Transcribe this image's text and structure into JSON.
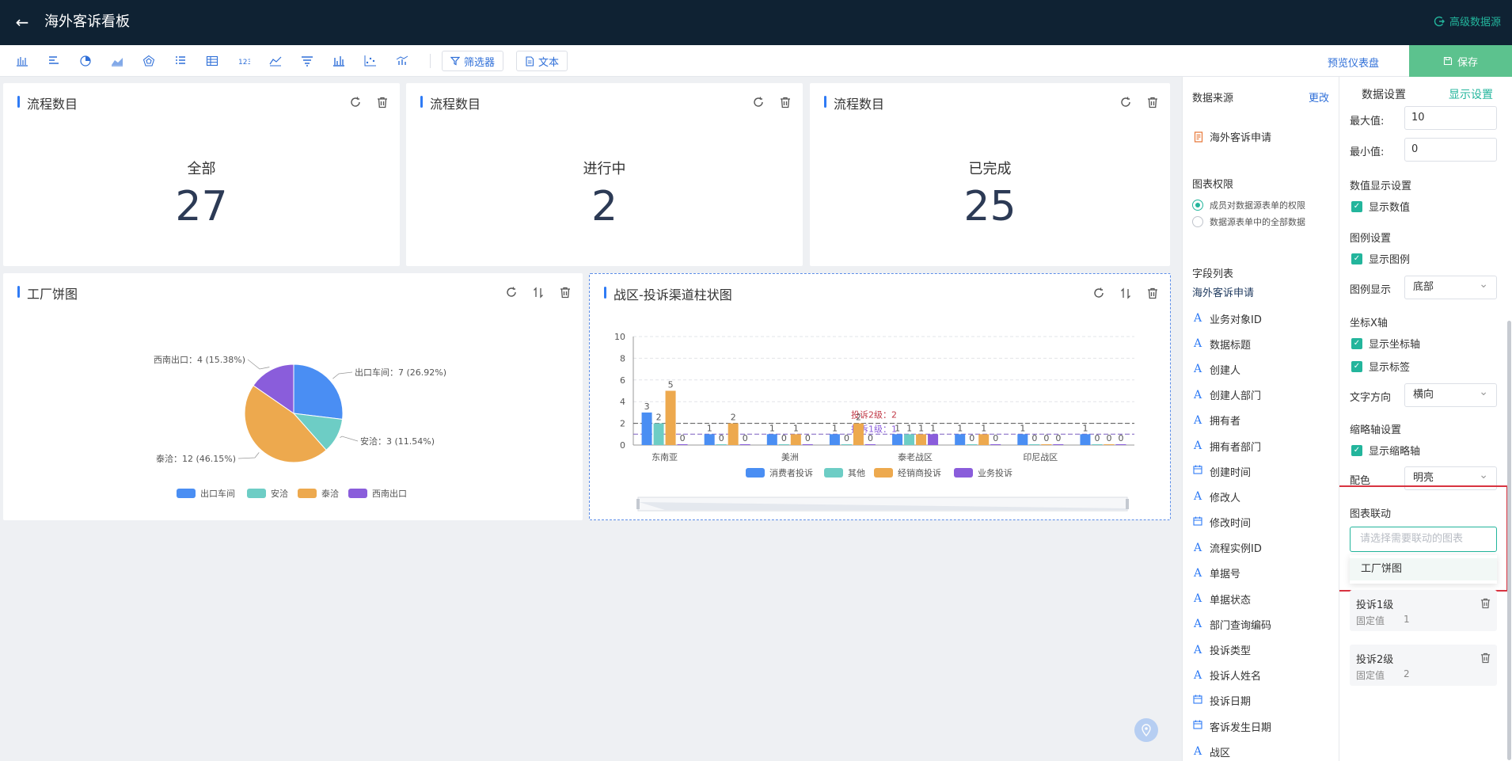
{
  "header": {
    "title": "海外客诉看板",
    "advanced_source": "高级数据源"
  },
  "toolbar": {
    "icons": [
      "bar-chart-icon",
      "horizontal-bar-icon",
      "pie-chart-icon",
      "area-chart-icon",
      "radar-chart-icon",
      "list-icon",
      "table-icon",
      "number-icon",
      "line-chart-icon",
      "funnel-icon",
      "column-chart-icon",
      "scatter-icon",
      "combo-chart-icon"
    ],
    "filter_label": "筛选器",
    "text_label": "文本",
    "preview_label": "预览仪表盘",
    "save_label": "保存"
  },
  "metrics": [
    {
      "title": "流程数目",
      "label": "全部",
      "value": "27"
    },
    {
      "title": "流程数目",
      "label": "进行中",
      "value": "2"
    },
    {
      "title": "流程数目",
      "label": "已完成",
      "value": "25"
    }
  ],
  "pie_card": {
    "title": "工厂饼图"
  },
  "bar_card": {
    "title": "战区-投诉渠道柱状图"
  },
  "chart_data": [
    {
      "type": "pie",
      "title": "工厂饼图",
      "categories": [
        "出口车间",
        "安洽",
        "泰洽",
        "西南出口"
      ],
      "values": [
        7,
        3,
        12,
        4
      ],
      "labels": [
        "出口车间：7 (26.92%)",
        "安洽：3 (11.54%)",
        "泰洽：12 (46.15%)",
        "西南出口：4 (15.38%)"
      ],
      "colors": [
        "#4a8ef3",
        "#6dcdc5",
        "#eda94e",
        "#8a5ddb"
      ],
      "legend": "bottom"
    },
    {
      "type": "bar",
      "title": "战区-投诉渠道柱状图",
      "ylim": [
        0,
        10
      ],
      "y_ticks": [
        "0",
        "2",
        "4",
        "6",
        "8",
        "10"
      ],
      "categories": [
        "东南亚",
        "",
        "美洲",
        "",
        "泰老战区",
        "",
        "印尼战区",
        ""
      ],
      "series": [
        {
          "name": "消费者投诉",
          "color": "#4a8ef3",
          "values": [
            3,
            1,
            1,
            1,
            1,
            1,
            1,
            1
          ]
        },
        {
          "name": "其他",
          "color": "#6dcdc5",
          "values": [
            2,
            0,
            0,
            0,
            1,
            0,
            0,
            0
          ]
        },
        {
          "name": "经销商投诉",
          "color": "#eda94e",
          "values": [
            5,
            2,
            1,
            2,
            1,
            1,
            0,
            0
          ]
        },
        {
          "name": "业务投诉",
          "color": "#8a5ddb",
          "values": [
            0,
            0,
            0,
            0,
            1,
            0,
            0,
            0
          ]
        }
      ],
      "reference_lines": [
        {
          "label": "投诉2级：2",
          "y": 2
        },
        {
          "label": "投诉1级：1",
          "y": 1
        }
      ],
      "grid": true,
      "legend": "bottom"
    }
  ],
  "field_panel": {
    "source_heading": "数据来源",
    "change_label": "更改",
    "source_name": "海外客诉申请",
    "perm_heading": "图表权限",
    "perm_options": [
      "成员对数据源表单的权限",
      "数据源表单中的全部数据"
    ],
    "fields_heading": "字段列表",
    "form_name": "海外客诉申请",
    "fields": [
      {
        "icon": "text-icon",
        "label": "业务对象ID"
      },
      {
        "icon": "text-icon",
        "label": "数据标题"
      },
      {
        "icon": "text-icon",
        "label": "创建人"
      },
      {
        "icon": "text-icon",
        "label": "创建人部门"
      },
      {
        "icon": "text-icon",
        "label": "拥有者"
      },
      {
        "icon": "text-icon",
        "label": "拥有者部门"
      },
      {
        "icon": "date-icon",
        "label": "创建时间"
      },
      {
        "icon": "text-icon",
        "label": "修改人"
      },
      {
        "icon": "date-icon",
        "label": "修改时间"
      },
      {
        "icon": "text-icon",
        "label": "流程实例ID"
      },
      {
        "icon": "text-icon",
        "label": "单据号"
      },
      {
        "icon": "text-icon",
        "label": "单据状态"
      },
      {
        "icon": "text-icon",
        "label": "部门查询编码"
      },
      {
        "icon": "text-icon",
        "label": "投诉类型"
      },
      {
        "icon": "text-icon",
        "label": "投诉人姓名"
      },
      {
        "icon": "date-icon",
        "label": "投诉日期"
      },
      {
        "icon": "date-icon",
        "label": "客诉发生日期"
      },
      {
        "icon": "text-icon",
        "label": "战区"
      }
    ]
  },
  "settings": {
    "tab_data": "数据设置",
    "tab_display": "显示设置",
    "max_label": "最大值:",
    "max_value": "10",
    "min_label": "最小值:",
    "min_value": "0",
    "value_display_heading": "数值显示设置",
    "show_value": "显示数值",
    "legend_heading": "图例设置",
    "show_legend": "显示图例",
    "legend_pos_label": "图例显示",
    "legend_pos_value": "底部",
    "xaxis_heading": "坐标X轴",
    "show_axis": "显示坐标轴",
    "show_labels": "显示标签",
    "text_dir_label": "文字方向",
    "text_dir_value": "横向",
    "zoom_heading": "缩略轴设置",
    "show_zoom": "显示缩略轴",
    "color_label": "配色",
    "color_value": "明亮",
    "linkage_heading": "图表联动",
    "linkage_placeholder": "请选择需要联动的图表",
    "linkage_option": "工厂饼图",
    "filters": [
      {
        "name": "投诉1级",
        "type": "固定值",
        "value": "1"
      },
      {
        "name": "投诉2级",
        "type": "固定值",
        "value": "2"
      }
    ]
  }
}
